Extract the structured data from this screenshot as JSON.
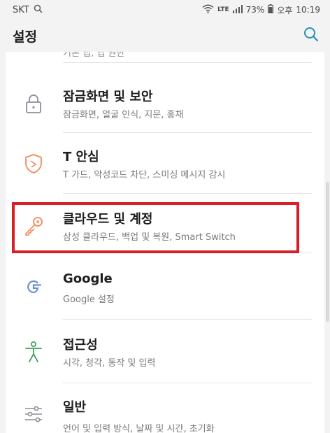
{
  "status_bar": {
    "carrier": "SKT",
    "network": "LTE",
    "battery": "73%",
    "ampm": "오후",
    "time": "10:19"
  },
  "app_bar": {
    "title": "설정"
  },
  "settings": {
    "cut_subtitle": "기본 앱, 앱 권한",
    "items": [
      {
        "title": "잠금화면 및 보안",
        "subtitle": "잠금화면, 얼굴 인식, 지문, 홍채",
        "icon": "lock-icon"
      },
      {
        "title": "T 안심",
        "subtitle": "T 가드, 악성코드 차단, 스미싱 메시지 감시",
        "icon": "shield-icon"
      },
      {
        "title": "클라우드 및 계정",
        "subtitle": "삼성 클라우드, 백업 및 복원, Smart Switch",
        "icon": "key-icon"
      },
      {
        "title": "Google",
        "subtitle": "Google 설정",
        "icon": "google-icon"
      },
      {
        "title": "접근성",
        "subtitle": "시각, 청각, 동작 및 입력",
        "icon": "accessibility-icon"
      },
      {
        "title": "일반",
        "subtitle": "언어 및 입력 방식, 날짜 및 시간, 초기화",
        "icon": "sliders-icon"
      }
    ]
  },
  "colors": {
    "highlight": "#d61f26",
    "accent": "#2a8fb0",
    "icon_gray": "#8a8f99",
    "icon_orange": "#f08a5a",
    "icon_green": "#3aa15a"
  }
}
